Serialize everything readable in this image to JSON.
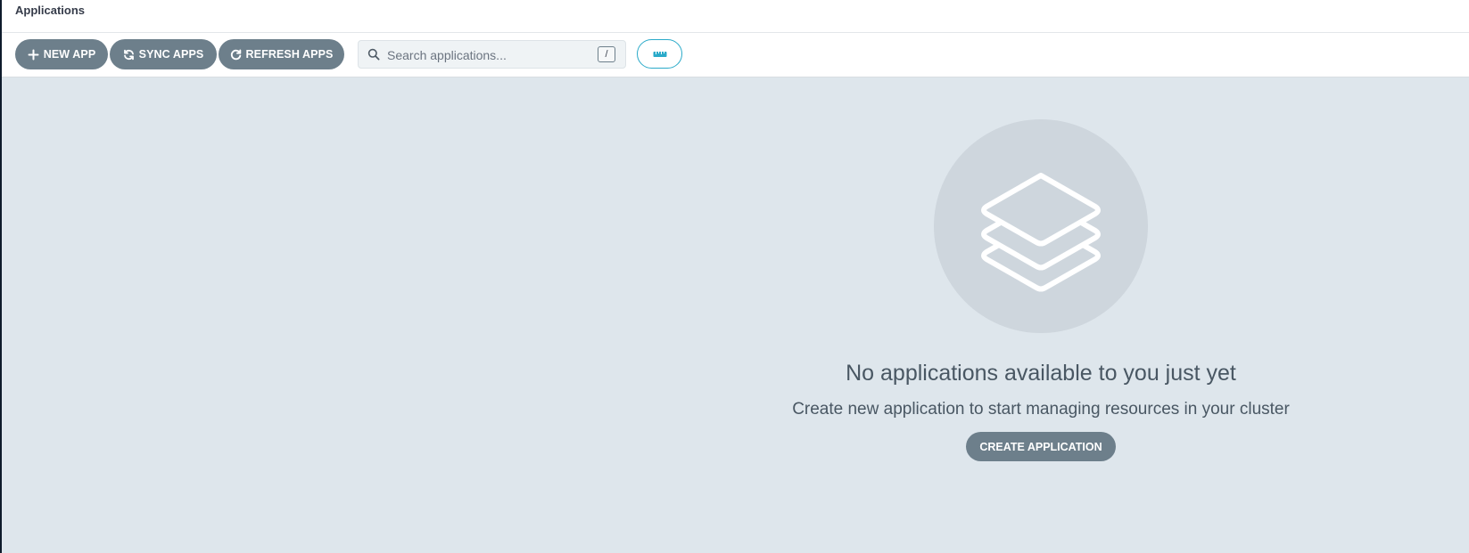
{
  "header": {
    "title": "Applications"
  },
  "toolbar": {
    "new_app_label": "NEW APP",
    "sync_apps_label": "SYNC APPS",
    "refresh_apps_label": "REFRESH APPS",
    "search_placeholder": "Search applications...",
    "search_value": "",
    "search_shortcut": "/",
    "view_toggle_icon": "ruler-icon"
  },
  "empty_state": {
    "icon": "layers-icon",
    "title": "No applications available to you just yet",
    "subtitle": "Create new application to start managing resources in your cluster",
    "create_label": "CREATE APPLICATION"
  },
  "colors": {
    "button_bg": "#6d7f8b",
    "page_bg": "#dee6ec",
    "accent": "#2aaac9",
    "text": "#495763"
  }
}
